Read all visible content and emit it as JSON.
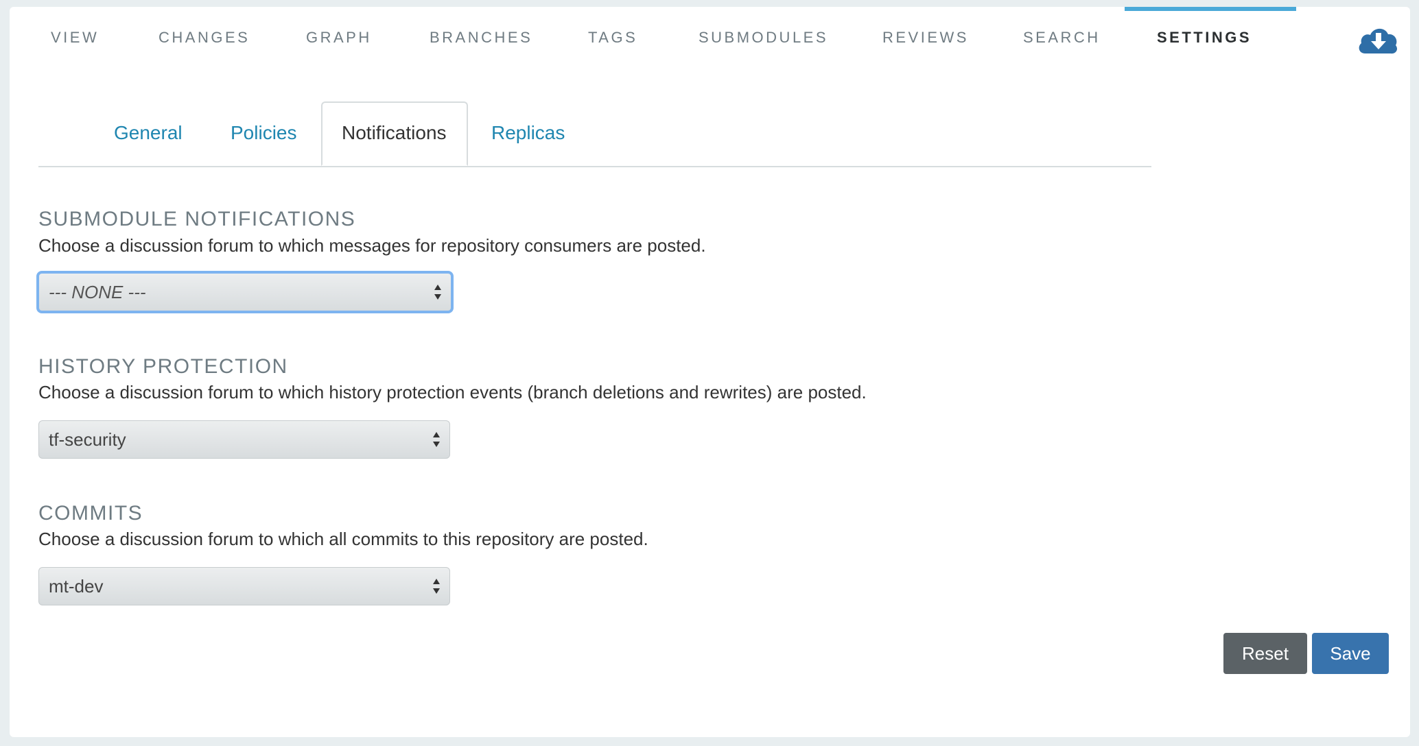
{
  "nav": {
    "items": [
      {
        "label": "VIEW"
      },
      {
        "label": "CHANGES"
      },
      {
        "label": "GRAPH"
      },
      {
        "label": "BRANCHES"
      },
      {
        "label": "TAGS"
      },
      {
        "label": "SUBMODULES"
      },
      {
        "label": "REVIEWS"
      },
      {
        "label": "SEARCH"
      },
      {
        "label": "SETTINGS",
        "active": true
      }
    ],
    "download_icon": "cloud-download-icon",
    "accent_color": "#4aa9d8"
  },
  "subtabs": [
    {
      "label": "General"
    },
    {
      "label": "Policies"
    },
    {
      "label": "Notifications",
      "active": true
    },
    {
      "label": "Replicas"
    }
  ],
  "sections": {
    "submodule": {
      "title": "SUBMODULE NOTIFICATIONS",
      "description": "Choose a discussion forum to which messages for repository consumers are posted.",
      "selected": "--- NONE ---"
    },
    "history": {
      "title": "HISTORY PROTECTION",
      "description": "Choose a discussion forum to which history protection events (branch deletions and rewrites) are posted.",
      "selected": "tf-security"
    },
    "commits": {
      "title": "COMMITS",
      "description": "Choose a discussion forum to which all commits to this repository are posted.",
      "selected": "mt-dev"
    }
  },
  "buttons": {
    "reset": "Reset",
    "save": "Save"
  }
}
